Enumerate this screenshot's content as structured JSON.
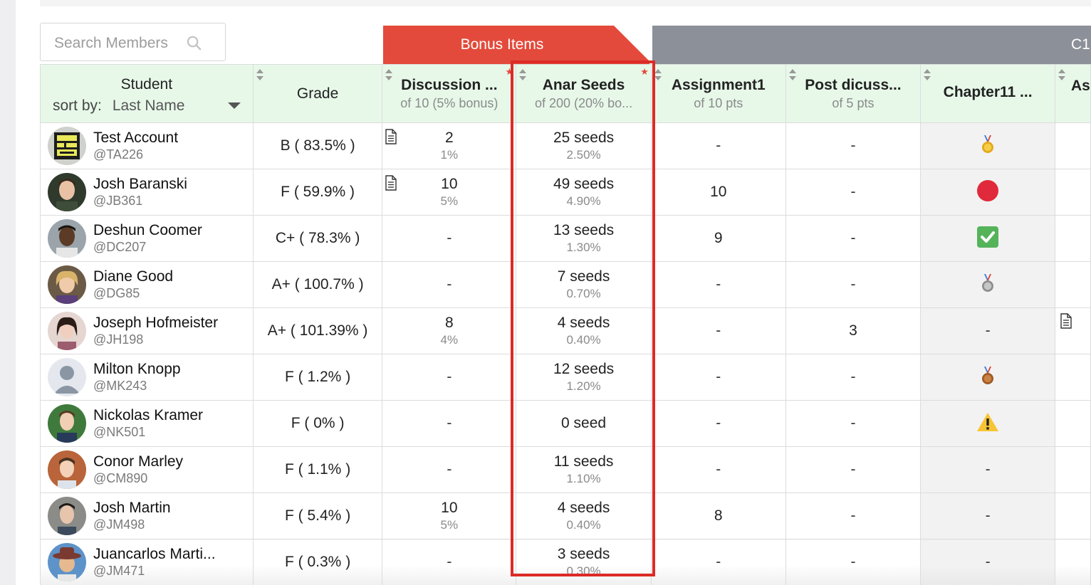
{
  "search": {
    "placeholder": "Search Members"
  },
  "groups": {
    "bonus": "Bonus Items",
    "c1": "C1"
  },
  "header": {
    "student": "Student",
    "sort_by_label": "sort by:",
    "sort_by_value": "Last Name",
    "grade": "Grade"
  },
  "columns": [
    {
      "title": "Discussion ...",
      "subtitle": "of 10 (5% bonus)",
      "bonus": true
    },
    {
      "title": "Anar Seeds",
      "subtitle": "of 200 (20% bo...",
      "bonus": true,
      "highlighted": true
    },
    {
      "title": "Assignment1",
      "subtitle": "of 10 pts"
    },
    {
      "title": "Post dicuss...",
      "subtitle": "of 5 pts"
    },
    {
      "title": "Chapter11 ...",
      "subtitle": ""
    },
    {
      "title": "As",
      "subtitle": ""
    }
  ],
  "colors": {
    "bonus_red": "#e34a3b",
    "header_green": "#e7f8e9",
    "highlight": "#dc2b27",
    "group_gray": "#8c9099"
  },
  "rows": [
    {
      "name": "Test Account",
      "handle": "@TA226",
      "grade": "B ( 83.5% )",
      "disc": {
        "main": "2",
        "sub": "1%"
      },
      "seeds": {
        "main": "25 seeds",
        "sub": "2.50%"
      },
      "assign1": "-",
      "post": "-",
      "chapter11": "gold-medal-icon"
    },
    {
      "name": "Josh Baranski",
      "handle": "@JB361",
      "grade": "F ( 59.9% )",
      "disc": {
        "main": "10",
        "sub": "5%"
      },
      "seeds": {
        "main": "49 seeds",
        "sub": "4.90%"
      },
      "assign1": "10",
      "post": "-",
      "chapter11": "red-circle-icon"
    },
    {
      "name": "Deshun Coomer",
      "handle": "@DC207",
      "grade": "C+ ( 78.3% )",
      "disc": {
        "main": "-",
        "sub": ""
      },
      "seeds": {
        "main": "13 seeds",
        "sub": "1.30%"
      },
      "assign1": "9",
      "post": "-",
      "chapter11": "check-mark-icon"
    },
    {
      "name": "Diane Good",
      "handle": "@DG85",
      "grade": "A+ ( 100.7% )",
      "disc": {
        "main": "-",
        "sub": ""
      },
      "seeds": {
        "main": "7 seeds",
        "sub": "0.70%"
      },
      "assign1": "-",
      "post": "-",
      "chapter11": "silver-medal-icon"
    },
    {
      "name": "Joseph Hofmeister",
      "handle": "@JH198",
      "grade": "A+ ( 101.39% )",
      "disc": {
        "main": "8",
        "sub": "4%"
      },
      "seeds": {
        "main": "4 seeds",
        "sub": "0.40%"
      },
      "assign1": "-",
      "post": "3",
      "chapter11": "-"
    },
    {
      "name": "Milton Knopp",
      "handle": "@MK243",
      "grade": "F ( 1.2% )",
      "disc": {
        "main": "-",
        "sub": ""
      },
      "seeds": {
        "main": "12 seeds",
        "sub": "1.20%"
      },
      "assign1": "-",
      "post": "-",
      "chapter11": "bronze-medal-icon"
    },
    {
      "name": "Nickolas Kramer",
      "handle": "@NK501",
      "grade": "F ( 0% )",
      "disc": {
        "main": "-",
        "sub": ""
      },
      "seeds": {
        "main": "0 seed",
        "sub": ""
      },
      "assign1": "-",
      "post": "-",
      "chapter11": "warning-icon"
    },
    {
      "name": "Conor Marley",
      "handle": "@CM890",
      "grade": "F ( 1.1% )",
      "disc": {
        "main": "-",
        "sub": ""
      },
      "seeds": {
        "main": "11 seeds",
        "sub": "1.10%"
      },
      "assign1": "-",
      "post": "-",
      "chapter11": "-"
    },
    {
      "name": "Josh Martin",
      "handle": "@JM498",
      "grade": "F ( 5.4% )",
      "disc": {
        "main": "10",
        "sub": "5%"
      },
      "seeds": {
        "main": "4 seeds",
        "sub": "0.40%"
      },
      "assign1": "8",
      "post": "-",
      "chapter11": "-"
    },
    {
      "name": "Juancarlos Marti...",
      "handle": "@JM471",
      "grade": "F ( 0.3% )",
      "disc": {
        "main": "-",
        "sub": ""
      },
      "seeds": {
        "main": "3 seeds",
        "sub": "0.30%"
      },
      "assign1": "-",
      "post": "-",
      "chapter11": "-"
    }
  ]
}
